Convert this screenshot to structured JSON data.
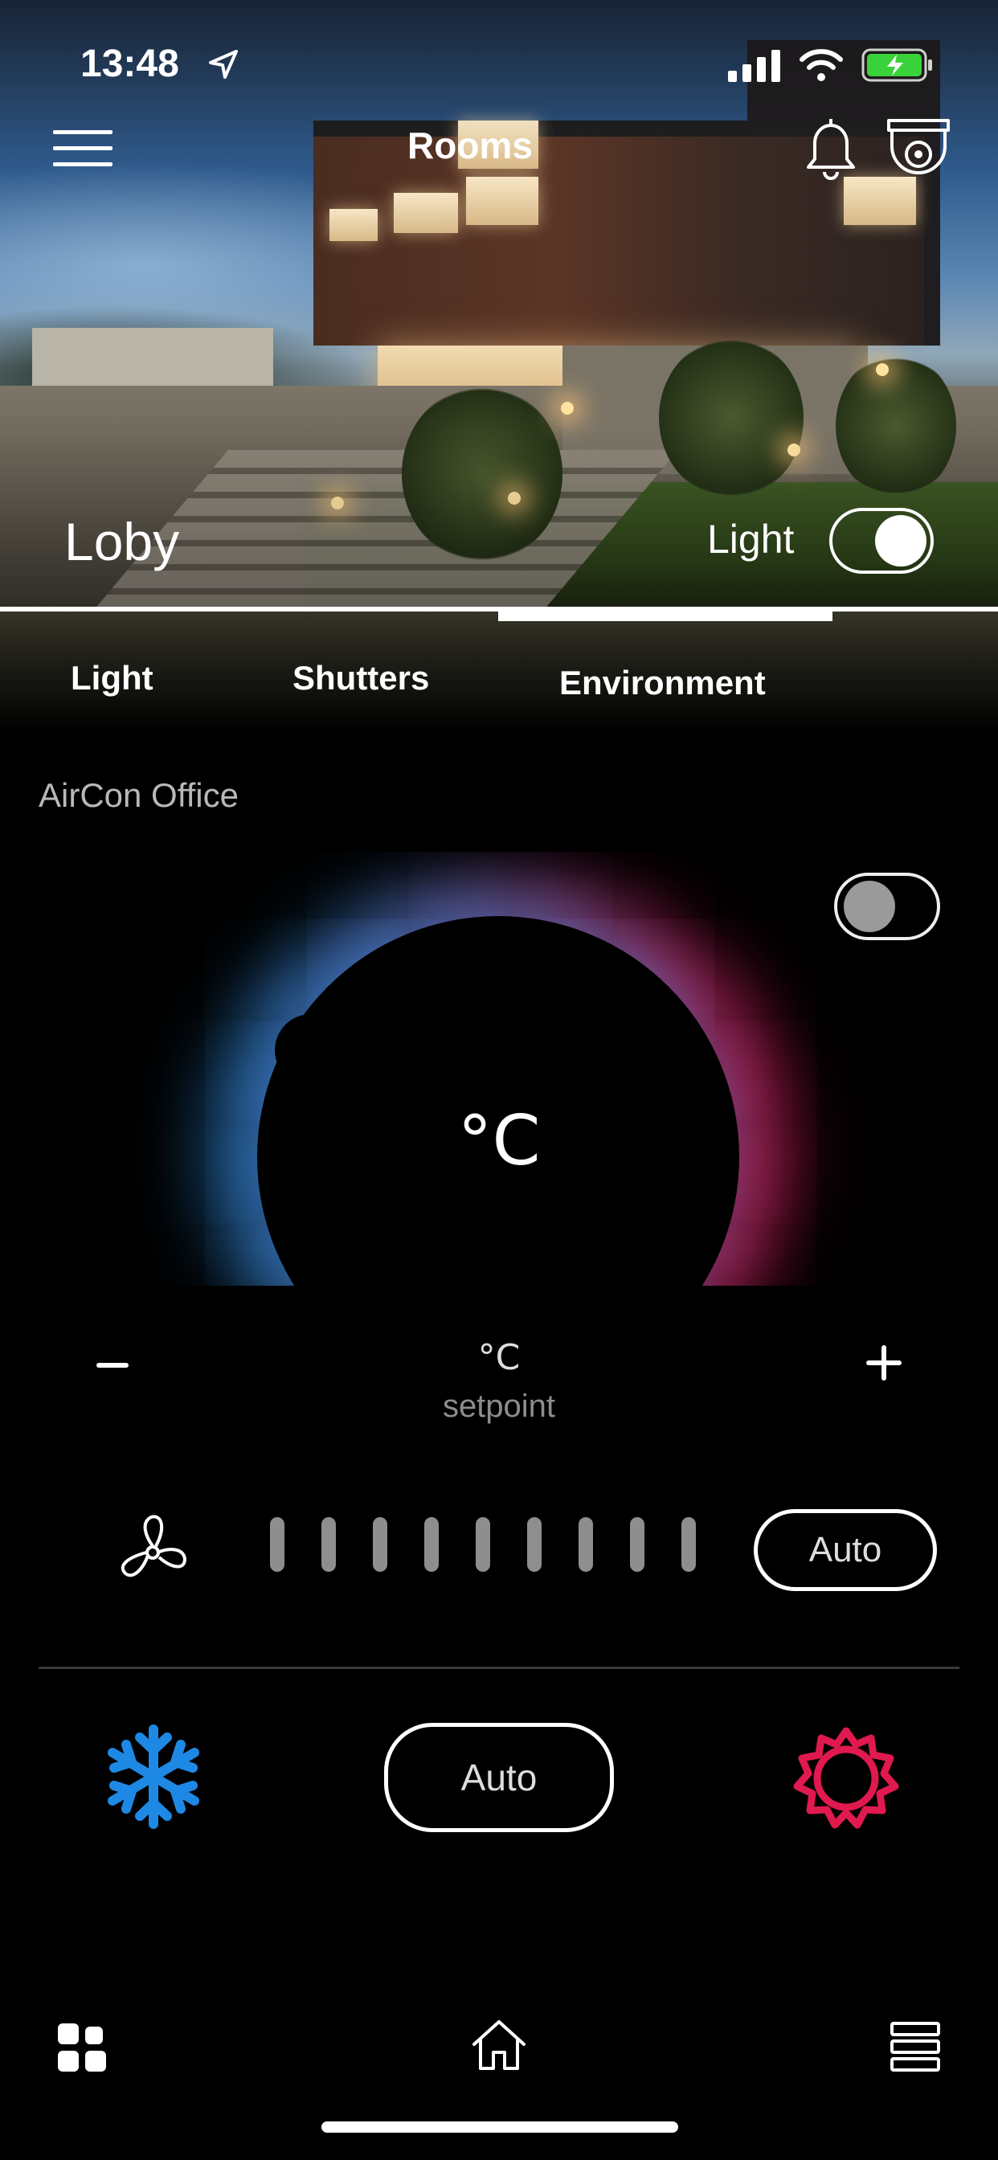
{
  "status_bar": {
    "time": "13:48"
  },
  "nav": {
    "title": "Rooms"
  },
  "room": {
    "name": "Loby",
    "light_label": "Light",
    "light_on": true
  },
  "tabs": [
    {
      "label": "Light",
      "active": false
    },
    {
      "label": "Shutters",
      "active": false
    },
    {
      "label": "Environment",
      "active": true
    }
  ],
  "device": {
    "name": "AirCon Office",
    "power_on": false,
    "temperature_unit": "°C",
    "setpoint_unit": "°C",
    "setpoint_label": "setpoint",
    "minus_label": "−",
    "plus_label": "+"
  },
  "fan": {
    "level_count": 9,
    "mode_label": "Auto"
  },
  "mode": {
    "label": "Auto"
  },
  "colors": {
    "cool": "#1e88e5",
    "heat": "#e0194f",
    "background": "#000000"
  },
  "icons": {
    "menu": "menu-icon",
    "bell": "bell-icon",
    "camera": "security-camera-icon",
    "fan": "fan-icon",
    "cool": "snowflake-icon",
    "heat": "sun-icon",
    "dashboard": "grid-icon",
    "home": "home-icon",
    "list": "list-icon"
  }
}
